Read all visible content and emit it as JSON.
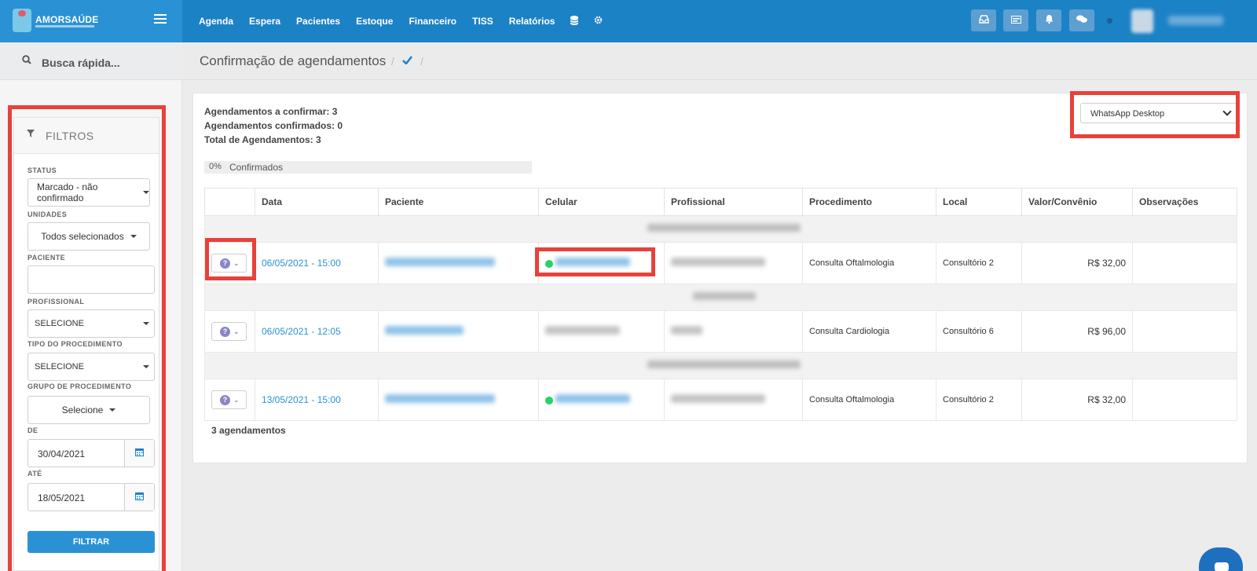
{
  "brand": {
    "name": "AMORSAÚDE"
  },
  "nav": {
    "items": [
      "Agenda",
      "Espera",
      "Pacientes",
      "Estoque",
      "Financeiro",
      "TISS",
      "Relatórios"
    ],
    "icons": [
      "database-icon",
      "gear-icon"
    ]
  },
  "topbar": {
    "icons": [
      "inbox-icon",
      "card-icon",
      "bell-icon",
      "chat-icon"
    ]
  },
  "sidebar": {
    "quick_search": "Busca rápida...",
    "filters": {
      "title": "FILTROS",
      "status_label": "STATUS",
      "status_value": "Marcado - não confirmado",
      "unidades_label": "UNIDADES",
      "unidades_value": "Todos selecionados",
      "paciente_label": "PACIENTE",
      "profissional_label": "PROFISSIONAL",
      "profissional_value": "SELECIONE",
      "tipo_label": "TIPO DO PROCEDIMENTO",
      "tipo_value": "SELECIONE",
      "grupo_label": "GRUPO DE PROCEDIMENTO",
      "grupo_value": "Selecione",
      "de_label": "DE",
      "de_value": "30/04/2021",
      "ate_label": "ATÉ",
      "ate_value": "18/05/2021",
      "filter_button": "FILTRAR"
    }
  },
  "page": {
    "title": "Confirmação de agendamentos",
    "breadcrumb_sep": "/"
  },
  "stats": {
    "to_confirm": "Agendamentos a confirmar: 3",
    "confirmed": "Agendamentos confirmados: 0",
    "total": "Total de Agendamentos: 3"
  },
  "progress": {
    "percent_text": "0%",
    "label": "Confirmados",
    "value": 0
  },
  "whatsapp_select": {
    "value": "WhatsApp Desktop"
  },
  "table": {
    "columns": [
      "",
      "Data",
      "Paciente",
      "Celular",
      "Profissional",
      "Procedimento",
      "Local",
      "Valor/Convênio",
      "Observações"
    ],
    "rows": [
      {
        "date": "06/05/2021 - 15:00",
        "procedure": "Consulta Oftalmologia",
        "local": "Consultório 2",
        "value": "R$ 32,00",
        "obs": ""
      },
      {
        "date": "06/05/2021 - 12:05",
        "procedure": "Consulta Cardiologia",
        "local": "Consultório 6",
        "value": "R$ 96,00",
        "obs": ""
      },
      {
        "date": "13/05/2021 - 15:00",
        "procedure": "Consulta Oftalmologia",
        "local": "Consultório 2",
        "value": "R$ 32,00",
        "obs": ""
      }
    ],
    "footer": "3 agendamentos"
  },
  "colors": {
    "primary": "#1c82c6",
    "highlight": "#e8413a",
    "whatsapp": "#25d366"
  }
}
